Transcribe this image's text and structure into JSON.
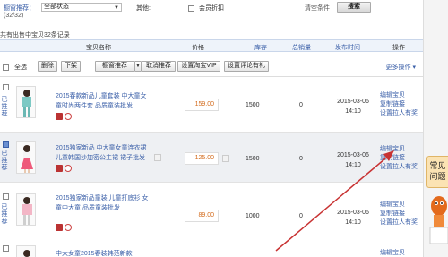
{
  "filters": {
    "label": "橱窗推荐：",
    "status_select": "全部状态",
    "other_label": "其他:",
    "member_discount": "会员折扣",
    "clear": "清空条件",
    "search": "搜索",
    "count": "(32/32)"
  },
  "info_line": "共有出售中宝贝32条记录",
  "header": {
    "name": "宝贝名称",
    "price": "价格",
    "stock": "库存",
    "sales": "总销量",
    "publish_time": "发布时间",
    "ops": "操作"
  },
  "toolbar": {
    "select_all": "全选",
    "delete": "删除",
    "delist": "下架",
    "recommend": "橱窗推荐",
    "cancel_recommend": "取消推荐",
    "set_vip": "设置淘宝VIP",
    "set_review": "设置评论有礼",
    "more_ops": "更多操作 ▾"
  },
  "rows": [
    {
      "status": "已推荐",
      "title": "2015春款新品儿童套装 中大童女童时尚两件套 品质童装批发",
      "price": "159.00",
      "stock": "1500",
      "sales": "0",
      "date": "2015-03-06",
      "time": "14:10",
      "ops": [
        "编辑宝贝",
        "复制链接",
        "设置拉人有奖"
      ],
      "checked": false
    },
    {
      "status": "已推荐",
      "title": "2015独家新品 中大童女童连衣裙 儿童韩国沙加密公主裙 裙子批发",
      "price": "125.00",
      "stock": "1500",
      "sales": "0",
      "date": "2015-03-06",
      "time": "14:10",
      "ops": [
        "编辑宝贝",
        "复制链接",
        "设置拉人有奖"
      ],
      "checked": true
    },
    {
      "status": "已推荐",
      "title": "2015独家新品童装 儿童打底衫 女童中大童 品质童装批发",
      "price": "89.00",
      "stock": "1000",
      "sales": "0",
      "date": "2015-03-06",
      "time": "14:10",
      "ops": [
        "编辑宝贝",
        "复制链接",
        "设置拉人有奖"
      ],
      "checked": false
    },
    {
      "status": "",
      "title": "中大女童2015春装韩范新款",
      "price": "",
      "stock": "",
      "sales": "",
      "date": "",
      "time": "",
      "ops": [
        "编辑宝贝"
      ],
      "checked": false
    }
  ],
  "help_tab": "常见问题",
  "colors": {
    "link_blue": "#3a5fa8",
    "price_orange": "#d36b1c",
    "header_bg": "#eef3fa",
    "annotation_red": "#c83232"
  }
}
